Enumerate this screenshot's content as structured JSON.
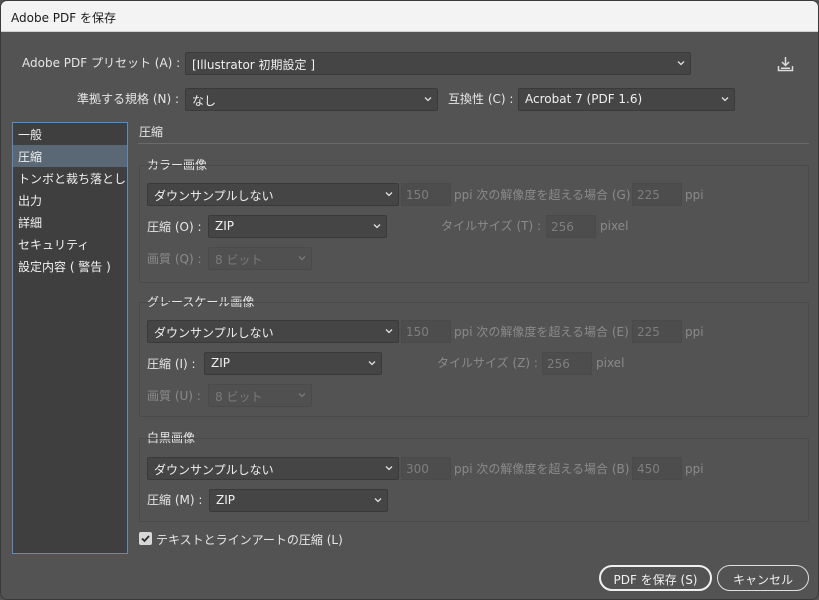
{
  "window": {
    "title": "Adobe PDF を保存"
  },
  "header": {
    "preset_label": "Adobe PDF プリセット (A) :",
    "preset_value": "[Illustrator 初期設定 ]",
    "standard_label": "準拠する規格 (N) :",
    "standard_value": "なし",
    "compat_label": "互換性 (C) :",
    "compat_value": "Acrobat 7 (PDF 1.6)",
    "save_preset_icon": "download-icon"
  },
  "sidebar": {
    "items": [
      {
        "label": "一般"
      },
      {
        "label": "圧縮"
      },
      {
        "label": "トンボと裁ち落とし"
      },
      {
        "label": "出力"
      },
      {
        "label": "詳細"
      },
      {
        "label": "セキュリティ"
      },
      {
        "label": "設定内容 ( 警告 )"
      }
    ],
    "active_index": 1
  },
  "panel": {
    "title": "圧縮",
    "color": {
      "title": "カラー画像",
      "downsample": "ダウンサンプルしない",
      "ppi_value": "150",
      "ppi_text": "ppi 次の解像度を超える場合 (G)",
      "above_value": "225",
      "above_unit": "ppi",
      "compression_label": "圧縮 (O) :",
      "compression_value": "ZIP",
      "tile_label": "タイルサイズ (T) :",
      "tile_value": "256",
      "tile_unit": "pixel",
      "quality_label": "画質 (Q) :",
      "quality_value": "8 ビット"
    },
    "gray": {
      "title": "グレースケール画像",
      "downsample": "ダウンサンプルしない",
      "ppi_value": "150",
      "ppi_text": "ppi 次の解像度を超える場合 (E)",
      "above_value": "225",
      "above_unit": "ppi",
      "compression_label": "圧縮 (I) :",
      "compression_value": "ZIP",
      "tile_label": "タイルサイズ (Z) :",
      "tile_value": "256",
      "tile_unit": "pixel",
      "quality_label": "画質 (U) :",
      "quality_value": "8 ビット"
    },
    "mono": {
      "title": "白黒画像",
      "downsample": "ダウンサンプルしない",
      "ppi_value": "300",
      "ppi_text": "ppi 次の解像度を超える場合 (B)",
      "above_value": "450",
      "above_unit": "ppi",
      "compression_label": "圧縮 (M) :",
      "compression_value": "ZIP"
    },
    "text_art": {
      "label": "テキストとラインアートの圧縮 (L)",
      "checked": true
    }
  },
  "footer": {
    "save_label": "PDF を保存 (S)",
    "cancel_label": "キャンセル"
  },
  "colors": {
    "background": "#535353",
    "field": "#454545",
    "sidebar": "#3f3f3f",
    "accent_border": "#5d8bbd",
    "active_item": "#5a6876"
  }
}
